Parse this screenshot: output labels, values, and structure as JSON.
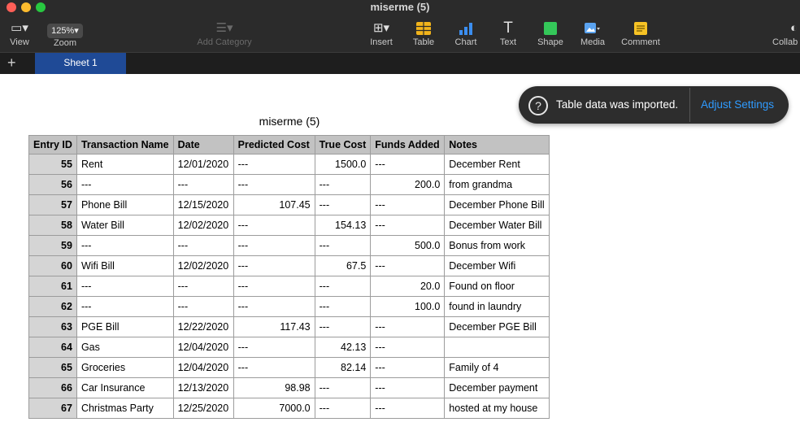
{
  "window": {
    "title": "miserme (5)"
  },
  "toolbar": {
    "view": {
      "label": "View",
      "icon": "sidebar-view-icon"
    },
    "zoom": {
      "label": "Zoom",
      "value": "125%"
    },
    "add_category": {
      "label": "Add Category"
    },
    "insert": {
      "label": "Insert"
    },
    "table": {
      "label": "Table"
    },
    "chart": {
      "label": "Chart"
    },
    "text": {
      "label": "Text"
    },
    "shape": {
      "label": "Shape"
    },
    "media": {
      "label": "Media"
    },
    "comment": {
      "label": "Comment"
    },
    "collaborate": {
      "label": "Collab"
    }
  },
  "tabs": {
    "add": "+",
    "sheets": [
      "Sheet 1"
    ]
  },
  "sheet": {
    "table_title": "miserme (5)",
    "columns": [
      "Entry ID",
      "Transaction Name",
      "Date",
      "Predicted Cost",
      "True Cost",
      "Funds Added",
      "Notes"
    ],
    "rows": [
      [
        "55",
        "Rent",
        "12/01/2020",
        "---",
        "1500.0",
        "---",
        "December Rent"
      ],
      [
        "56",
        "---",
        "---",
        "---",
        "---",
        "200.0",
        "from grandma"
      ],
      [
        "57",
        "Phone Bill",
        "12/15/2020",
        "107.45",
        "---",
        "---",
        "December Phone Bill"
      ],
      [
        "58",
        "Water Bill",
        "12/02/2020",
        "---",
        "154.13",
        "---",
        "December Water Bill"
      ],
      [
        "59",
        "---",
        "---",
        "---",
        "---",
        "500.0",
        "Bonus from work"
      ],
      [
        "60",
        "Wifi Bill",
        "12/02/2020",
        "---",
        "67.5",
        "---",
        "December Wifi"
      ],
      [
        "61",
        "---",
        "---",
        "---",
        "---",
        "20.0",
        "Found on floor"
      ],
      [
        "62",
        "---",
        "---",
        "---",
        "---",
        "100.0",
        "found in laundry"
      ],
      [
        "63",
        "PGE Bill",
        "12/22/2020",
        "117.43",
        "---",
        "---",
        "December PGE Bill"
      ],
      [
        "64",
        "Gas",
        "12/04/2020",
        "---",
        "42.13",
        "---",
        ""
      ],
      [
        "65",
        "Groceries",
        "12/04/2020",
        "---",
        "82.14",
        "---",
        "Family of 4"
      ],
      [
        "66",
        "Car Insurance",
        "12/13/2020",
        "98.98",
        "---",
        "---",
        "December payment"
      ],
      [
        "67",
        "Christmas Party",
        "12/25/2020",
        "7000.0",
        "---",
        "---",
        "hosted at my house"
      ]
    ]
  },
  "toast": {
    "message": "Table data was imported.",
    "action": "Adjust Settings"
  },
  "colors": {
    "accent": "#2f9bff",
    "sheet_tab": "#1f4a96",
    "table_icon": "#f2b41b",
    "chart_icon": "#3b8ef0",
    "shape_icon": "#34c759"
  }
}
